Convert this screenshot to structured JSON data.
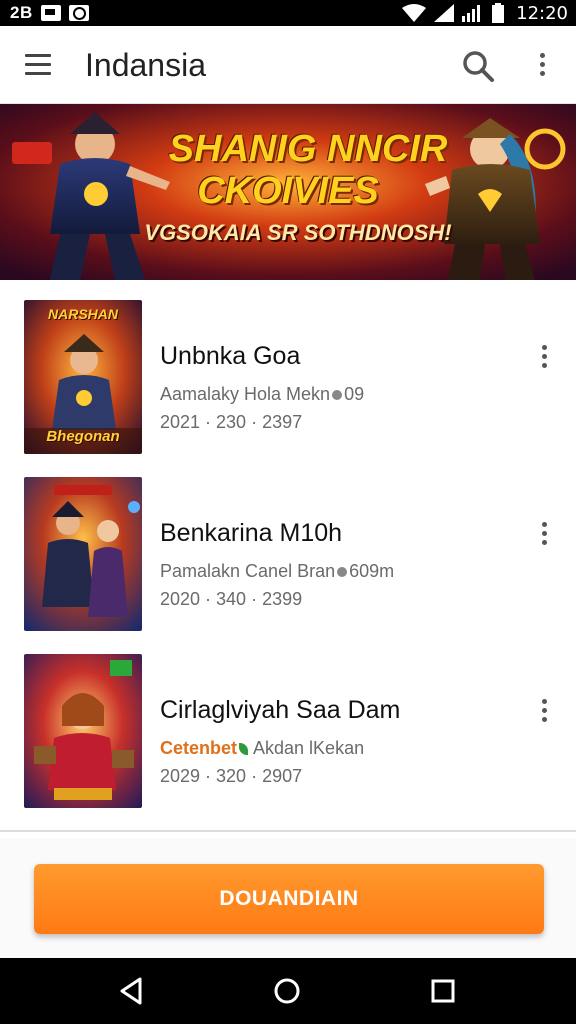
{
  "status_bar": {
    "left_text": "2B",
    "time": "12:20",
    "icons": [
      "image-notification-icon",
      "flag-notification-icon",
      "record-notification-icon",
      "wifi-icon",
      "signal-icon",
      "signal-icon",
      "battery-icon"
    ]
  },
  "app_bar": {
    "title": "Indansia",
    "icons": [
      "menu-icon",
      "search-icon",
      "more-vert-icon"
    ]
  },
  "banner": {
    "line1": "SHANIG NNCIR",
    "line2": "CKOIVIES",
    "line3": "VGSOKAIA SR SOTHDNOSH!"
  },
  "list": {
    "items": [
      {
        "title": "Unbnka Goa",
        "subtitle_prefix": "",
        "subtitle": "Aamalaky Hola Mekn",
        "subtitle_suffix": "09",
        "date": "2021 · 230 · 2397",
        "thumb_caption_top": "NARSHAN",
        "thumb_caption_bottom": "Bhegonan"
      },
      {
        "title": "Benkarina M10h",
        "subtitle_prefix": "",
        "subtitle": "Pamalakn Canel Bran",
        "subtitle_suffix": "609m",
        "date": "2020 · 340 · 2399",
        "thumb_caption_top": "",
        "thumb_caption_bottom": ""
      },
      {
        "title": "Cirlaglviyah Saa Dam",
        "subtitle_prefix": "Cetenbet",
        "subtitle": "Akdan lKekan",
        "subtitle_suffix": "",
        "date": "2029 · 320 · 2907",
        "thumb_caption_top": "",
        "thumb_caption_bottom": ""
      }
    ]
  },
  "download_button": {
    "label": "DOUANDIAIN"
  },
  "nav_bar": {
    "icons": [
      "back-icon",
      "home-icon",
      "recents-icon"
    ]
  },
  "colors": {
    "accent": "#ff7f1a",
    "status_bar": "#000000",
    "title_text": "#222222",
    "subtitle_text": "#6a6a6a"
  }
}
